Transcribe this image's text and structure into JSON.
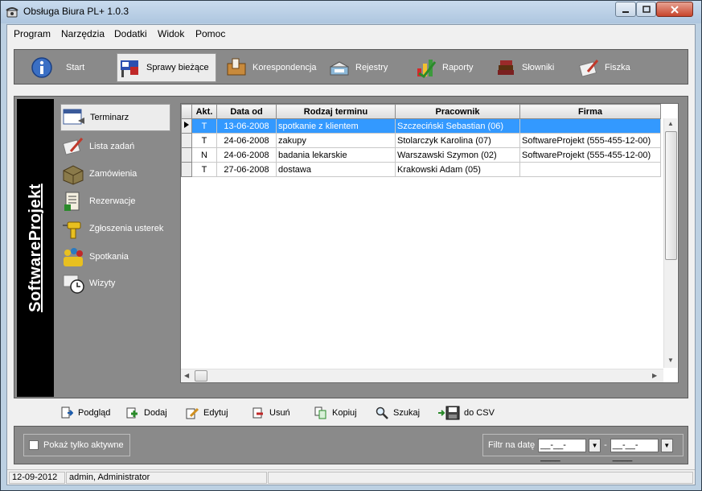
{
  "window": {
    "title": "Obsługa Biura PL+ 1.0.3"
  },
  "menu": [
    {
      "label": "Program"
    },
    {
      "label": "Narzędzia"
    },
    {
      "label": "Dodatki"
    },
    {
      "label": "Widok"
    },
    {
      "label": "Pomoc"
    }
  ],
  "toolbar": [
    {
      "label": "Start",
      "icon": "info-icon"
    },
    {
      "label": "Sprawy bieżące",
      "icon": "desk-icon",
      "active": true
    },
    {
      "label": "Korespondencja",
      "icon": "mail-icon"
    },
    {
      "label": "Rejestry",
      "icon": "registry-icon"
    },
    {
      "label": "Raporty",
      "icon": "chart-icon"
    },
    {
      "label": "Słowniki",
      "icon": "books-icon"
    },
    {
      "label": "Fiszka",
      "icon": "note-icon"
    }
  ],
  "brand": "SoftwareProjekt",
  "sidenav": [
    {
      "label": "Terminarz",
      "icon": "calendar-icon",
      "active": true
    },
    {
      "label": "Lista zadań",
      "icon": "tasklist-icon"
    },
    {
      "label": "Zamówienia",
      "icon": "package-icon"
    },
    {
      "label": "Rezerwacje",
      "icon": "reservation-icon"
    },
    {
      "label": "Zgłoszenia usterek",
      "icon": "drill-icon"
    },
    {
      "label": "Spotkania",
      "icon": "people-icon"
    },
    {
      "label": "Wizyty",
      "icon": "clock-icon"
    }
  ],
  "grid": {
    "columns": [
      "",
      "Akt.",
      "Data od",
      "Rodzaj terminu",
      "Pracownik",
      "Firma"
    ],
    "rows": [
      {
        "akt": "T",
        "date": "13-06-2008",
        "type": "spotkanie z klientem",
        "employee": "Szczeciński Sebastian (06)",
        "company": "",
        "selected": true
      },
      {
        "akt": "T",
        "date": "24-06-2008",
        "type": "zakupy",
        "employee": "Stolarczyk Karolina (07)",
        "company": "SoftwareProjekt (555-455-12-00)"
      },
      {
        "akt": "N",
        "date": "24-06-2008",
        "type": "badania lekarskie",
        "employee": "Warszawski Szymon (02)",
        "company": "SoftwareProjekt (555-455-12-00)"
      },
      {
        "akt": "T",
        "date": "27-06-2008",
        "type": "dostawa",
        "employee": "Krakowski Adam (05)",
        "company": ""
      }
    ]
  },
  "actions": [
    {
      "label": "Podgląd",
      "icon": "preview-icon"
    },
    {
      "label": "Dodaj",
      "icon": "add-icon"
    },
    {
      "label": "Edytuj",
      "icon": "edit-icon"
    },
    {
      "label": "Usuń",
      "icon": "delete-icon"
    },
    {
      "label": "Kopiuj",
      "icon": "copy-icon"
    },
    {
      "label": "Szukaj",
      "icon": "search-icon"
    },
    {
      "label": "do CSV",
      "icon": "save-icon"
    }
  ],
  "filters": {
    "only_active_label": "Pokaż tylko aktywne",
    "date_filter_label": "Filtr na datę",
    "date_from": "__-__-____",
    "date_to": "__-__-____",
    "separator": "-"
  },
  "status": {
    "date": "12-09-2012",
    "user": "admin, Administrator"
  }
}
